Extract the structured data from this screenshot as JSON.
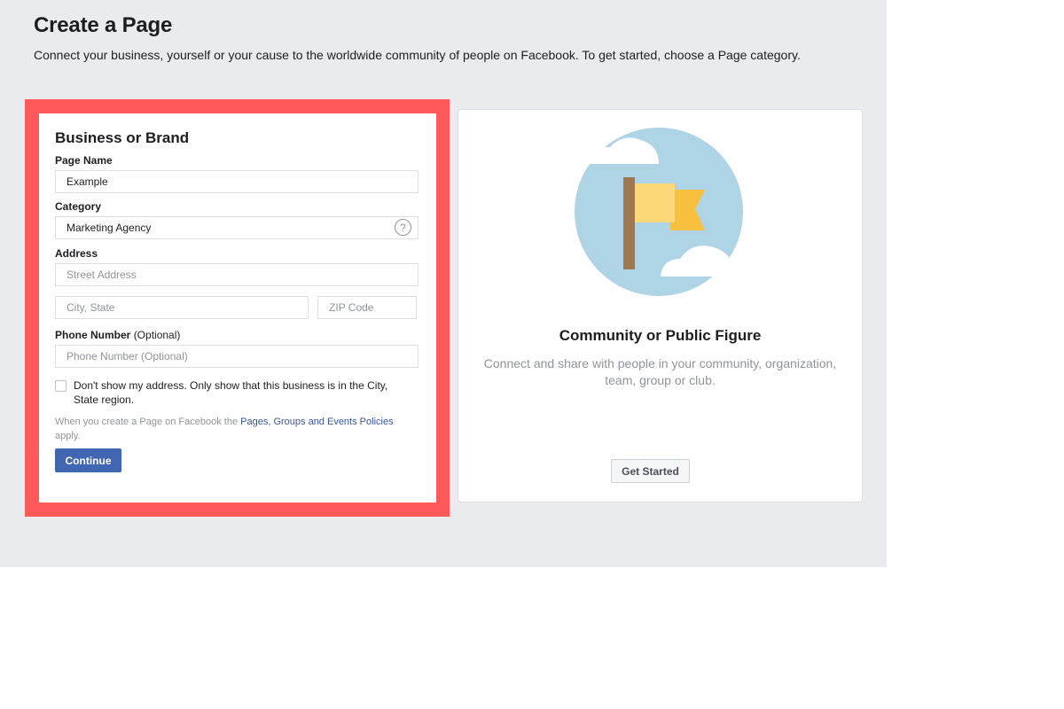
{
  "header": {
    "title": "Create a Page",
    "subtitle": "Connect your business, yourself or your cause to the worldwide community of people on Facebook. To get started, choose a Page category."
  },
  "business_card": {
    "title": "Business or Brand",
    "page_name": {
      "label": "Page Name",
      "value": "Example"
    },
    "category": {
      "label": "Category",
      "value": "Marketing Agency",
      "help_glyph": "?"
    },
    "address": {
      "label": "Address",
      "street_placeholder": "Street Address",
      "city_placeholder": "City, State",
      "zip_placeholder": "ZIP Code"
    },
    "phone": {
      "label": "Phone Number",
      "label_optional": "(Optional)",
      "placeholder": "Phone Number (Optional)"
    },
    "hide_address_checkbox": {
      "label": "Don't show my address. Only show that this business is in the City, State region.",
      "checked": false
    },
    "policy": {
      "prefix": "When you create a Page on Facebook the ",
      "link": "Pages, Groups and Events Policies",
      "suffix": " apply."
    },
    "continue_label": "Continue"
  },
  "community_card": {
    "title": "Community or Public Figure",
    "description": "Connect and share with people in your community, organization, team, group or club.",
    "get_started_label": "Get Started",
    "illustration_icon": "flag-icon"
  },
  "colors": {
    "page_background": "#e9ebee",
    "highlight": "#ff5a5a",
    "primary_button": "#4267b2",
    "link": "#365899",
    "circle": "#afd4e6",
    "flag": "#f7c13f",
    "flag_light": "#fcd87a",
    "pole": "#a0784f"
  }
}
